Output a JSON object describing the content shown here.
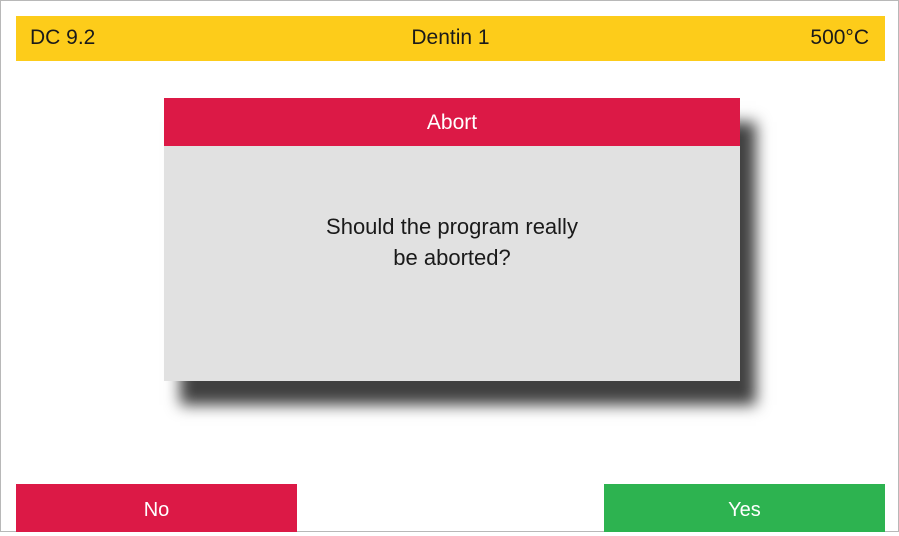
{
  "status_bar": {
    "program_code": "DC 9.2",
    "program_name": "Dentin 1",
    "temperature": "500°C"
  },
  "dialog": {
    "title": "Abort",
    "message_line1": "Should the program really",
    "message_line2": "be aborted?"
  },
  "buttons": {
    "no_label": "No",
    "yes_label": "Yes"
  },
  "colors": {
    "status_bar": "#fdcc1a",
    "dialog_header": "#dc1946",
    "dialog_body": "#e1e1e1",
    "no_button": "#dc1946",
    "yes_button": "#2db350"
  }
}
